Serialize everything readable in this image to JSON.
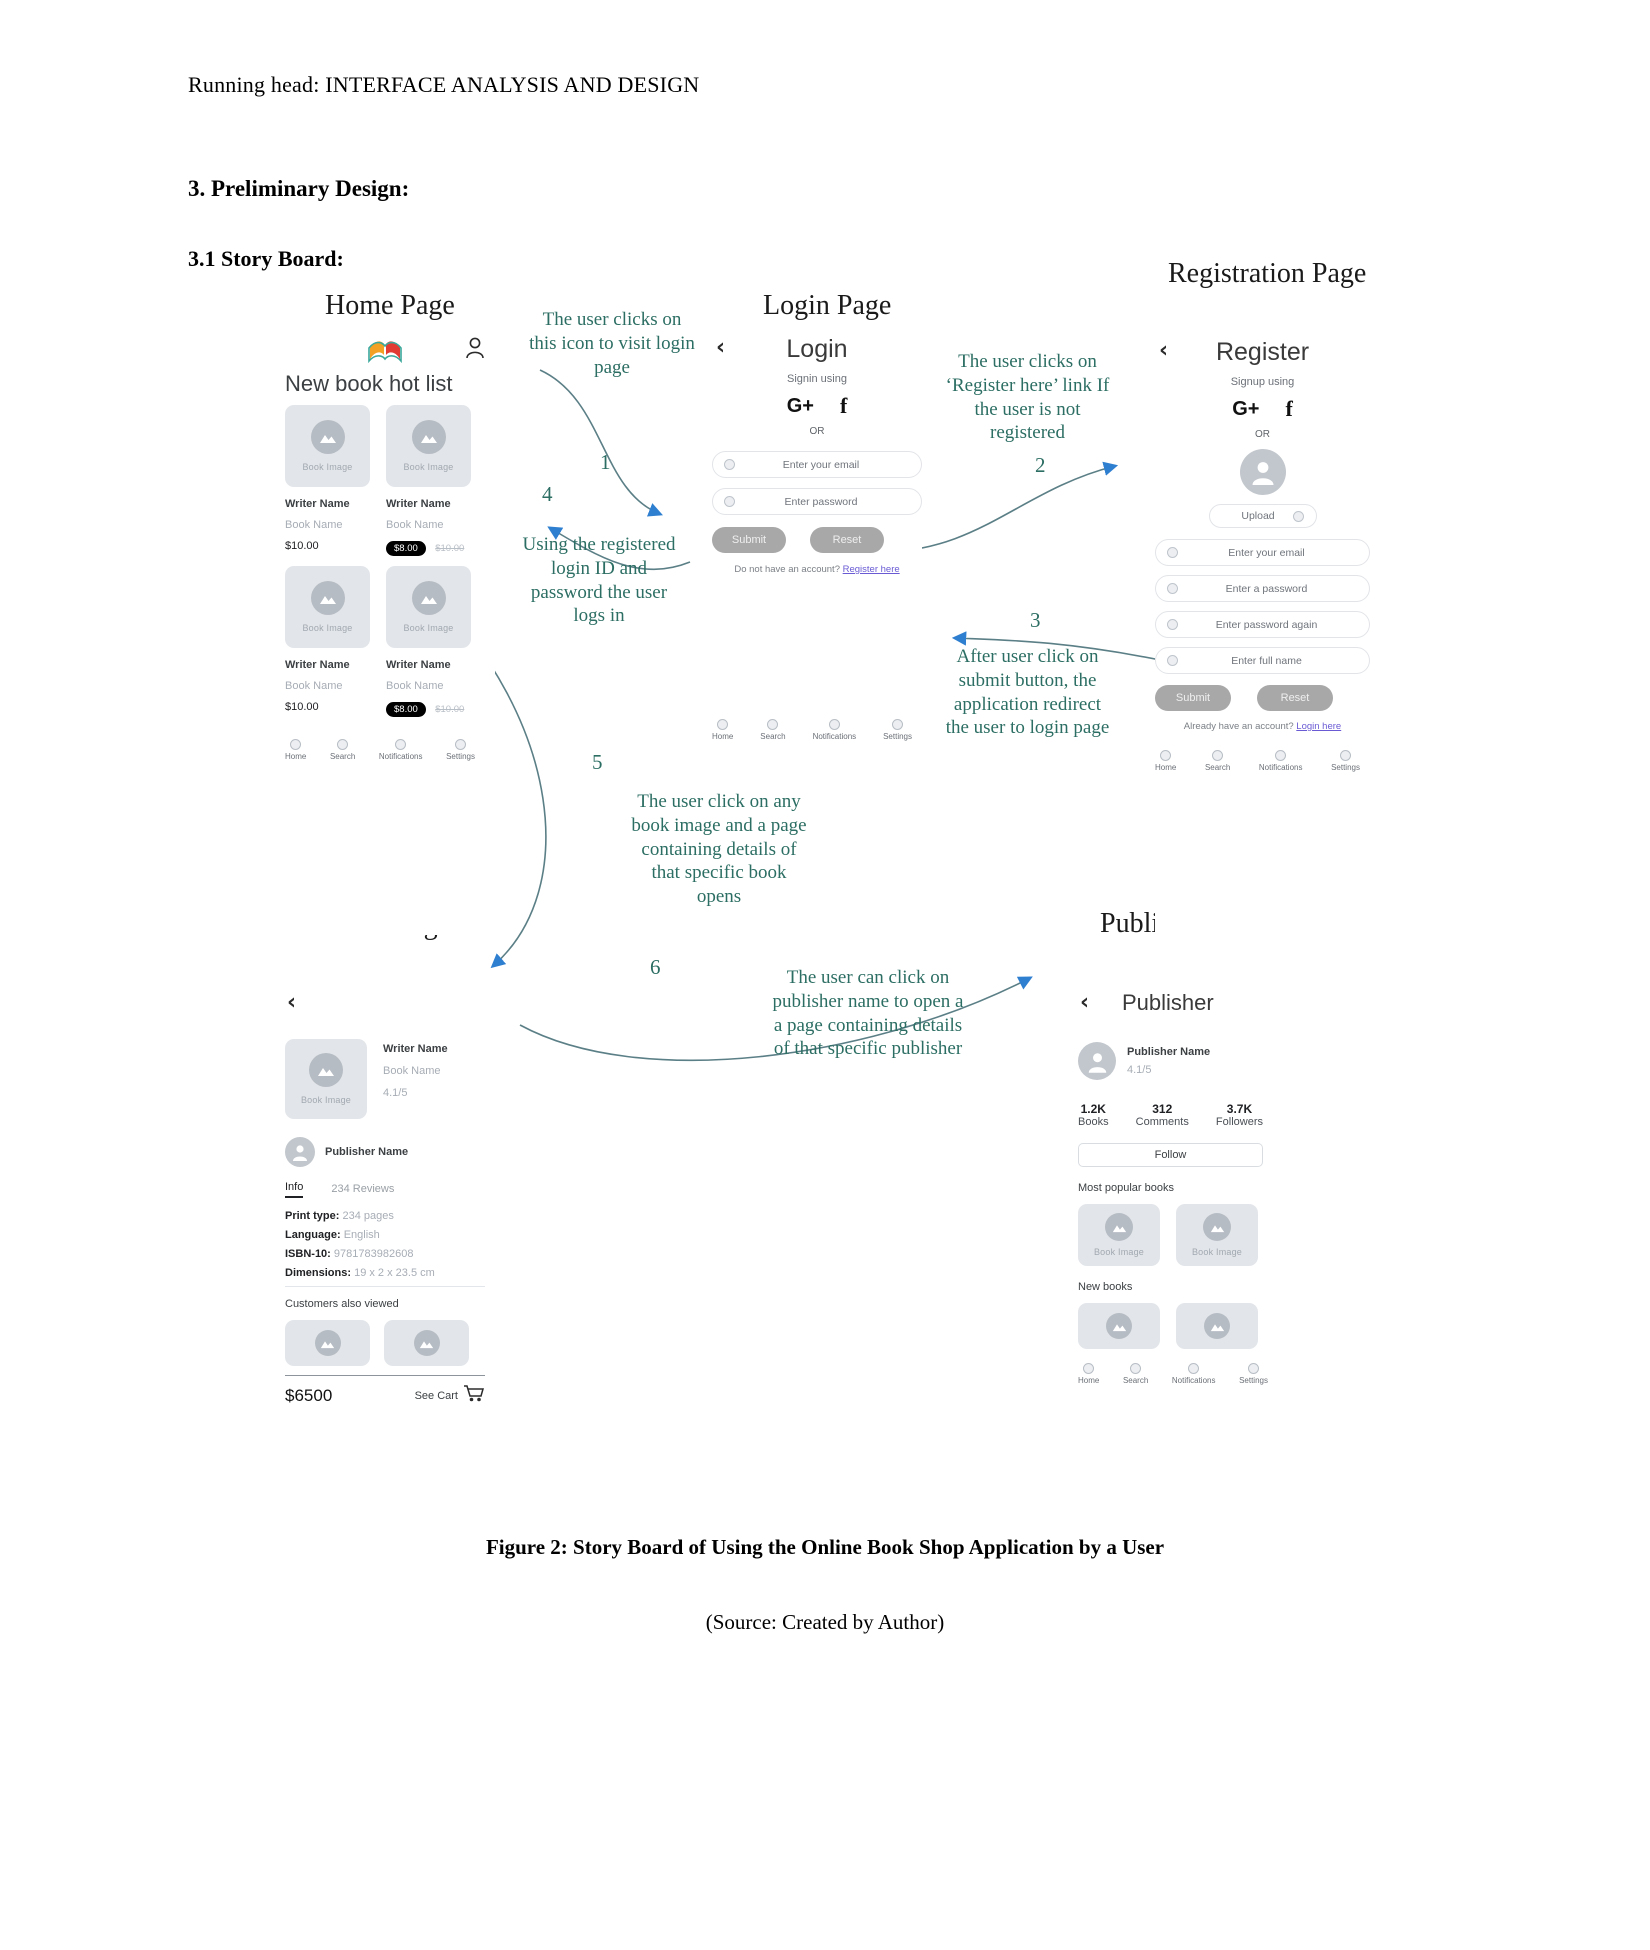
{
  "document": {
    "running_head": "Running head: INTERFACE ANALYSIS AND DESIGN",
    "section_heading": "3. Preliminary Design:",
    "subsection_heading": "3.1 Story Board:",
    "figure_caption": "Figure 2: Story Board of Using the Online Book Shop Application by a User",
    "source_caption": "(Source: Created by Author)"
  },
  "panel_titles": {
    "home": "Home Page",
    "login": "Login Page",
    "registration": "Registration Page",
    "book": "Book Page",
    "publisher": "Publisher Page"
  },
  "home_screen": {
    "app_title": "New book hot list",
    "logo_icon": "open-book-icon",
    "profile_icon": "person-icon",
    "books": [
      {
        "image_caption": "Book Image",
        "writer": "Writer Name",
        "book": "Book Name",
        "price": "$10.00",
        "badge": null,
        "strike": null
      },
      {
        "image_caption": "Book Image",
        "writer": "Writer Name",
        "book": "Book Name",
        "price": null,
        "badge": "$8.00",
        "strike": "$10.00"
      },
      {
        "image_caption": "Book Image",
        "writer": "Writer Name",
        "book": "Book Name",
        "price": "$10.00",
        "badge": null,
        "strike": null
      },
      {
        "image_caption": "Book Image",
        "writer": "Writer Name",
        "book": "Book Name",
        "price": null,
        "badge": "$8.00",
        "strike": "$10.00"
      }
    ],
    "nav": [
      "Home",
      "Search",
      "Notifications",
      "Settings"
    ]
  },
  "login_screen": {
    "back_icon": "chevron-left-icon",
    "title": "Login",
    "social_caption": "Signin using",
    "social": [
      "G+",
      "f"
    ],
    "or": "OR",
    "fields": [
      {
        "placeholder": "Enter your email"
      },
      {
        "placeholder": "Enter password"
      }
    ],
    "submit_label": "Submit",
    "reset_label": "Reset",
    "footer_text": "Do not have an account?",
    "footer_link": "Register here",
    "nav": [
      "Home",
      "Search",
      "Notifications",
      "Settings"
    ]
  },
  "register_screen": {
    "back_icon": "chevron-left-icon",
    "title": "Register",
    "social_caption": "Signup using",
    "social": [
      "G+",
      "f"
    ],
    "or": "OR",
    "avatar_icon": "person-avatar-icon",
    "upload_label": "Upload",
    "fields": [
      {
        "placeholder": "Enter your email"
      },
      {
        "placeholder": "Enter a password"
      },
      {
        "placeholder": "Enter password again"
      },
      {
        "placeholder": "Enter full name"
      }
    ],
    "submit_label": "Submit",
    "reset_label": "Reset",
    "footer_text": "Already have an account?",
    "footer_link": "Login here",
    "nav": [
      "Home",
      "Search",
      "Notifications",
      "Settings"
    ]
  },
  "book_screen": {
    "back_icon": "chevron-left-icon",
    "cover_caption": "Book Image",
    "writer": "Writer Name",
    "book": "Book Name",
    "rating": "4.1/5",
    "publisher_name": "Publisher Name",
    "tabs": [
      {
        "label": "Info",
        "active": true
      },
      {
        "label": "234 Reviews",
        "active": false
      }
    ],
    "info": [
      {
        "label": "Print type:",
        "value": "234 pages"
      },
      {
        "label": "Language:",
        "value": "English"
      },
      {
        "label": "ISBN-10:",
        "value": "9781783982608"
      },
      {
        "label": "Dimensions:",
        "value": "19 x 2 x 23.5 cm"
      }
    ],
    "also_viewed_label": "Customers also viewed",
    "also_viewed": [
      "",
      ""
    ],
    "total_price": "$6500",
    "cart_label": "See Cart",
    "cart_icon": "shopping-cart-icon"
  },
  "publisher_screen": {
    "back_icon": "chevron-left-icon",
    "title": "Publisher",
    "publisher_name": "Publisher Name",
    "rating": "4.1/5",
    "stats": [
      {
        "number": "1.2K",
        "label": "Books"
      },
      {
        "number": "312",
        "label": "Comments"
      },
      {
        "number": "3.7K",
        "label": "Followers"
      }
    ],
    "follow_label": "Follow",
    "popular_label": "Most popular books",
    "popular_books": [
      {
        "caption": "Book Image"
      },
      {
        "caption": "Book Image"
      }
    ],
    "new_label": "New books",
    "new_books": [
      {
        "caption": ""
      },
      {
        "caption": ""
      }
    ],
    "nav": [
      "Home",
      "Search",
      "Notifications",
      "Settings"
    ]
  },
  "annotations": [
    {
      "id": 1,
      "number": "1",
      "text": "The user clicks on this icon to visit login page"
    },
    {
      "id": 2,
      "number": "2",
      "text": "The user clicks on ‘Register here’ link If the user is not registered"
    },
    {
      "id": 3,
      "number": "3",
      "text": "After user click on submit button, the application redirect the user to login page"
    },
    {
      "id": 4,
      "number": "4",
      "text": "Using the registered login ID and password the user logs in"
    },
    {
      "id": 5,
      "number": "5",
      "text": "The user click on any book image and a page containing details of that specific book opens"
    },
    {
      "id": 6,
      "number": "6",
      "text": "The user can click on publisher name to open a a page containing details of that specific publisher"
    }
  ],
  "colors": {
    "annotation_text": "#2c6e63",
    "arrow": "#5b7f86",
    "arrow_head": "#2f7fd0",
    "badge": "#000000",
    "link": "#6a5bd4"
  }
}
